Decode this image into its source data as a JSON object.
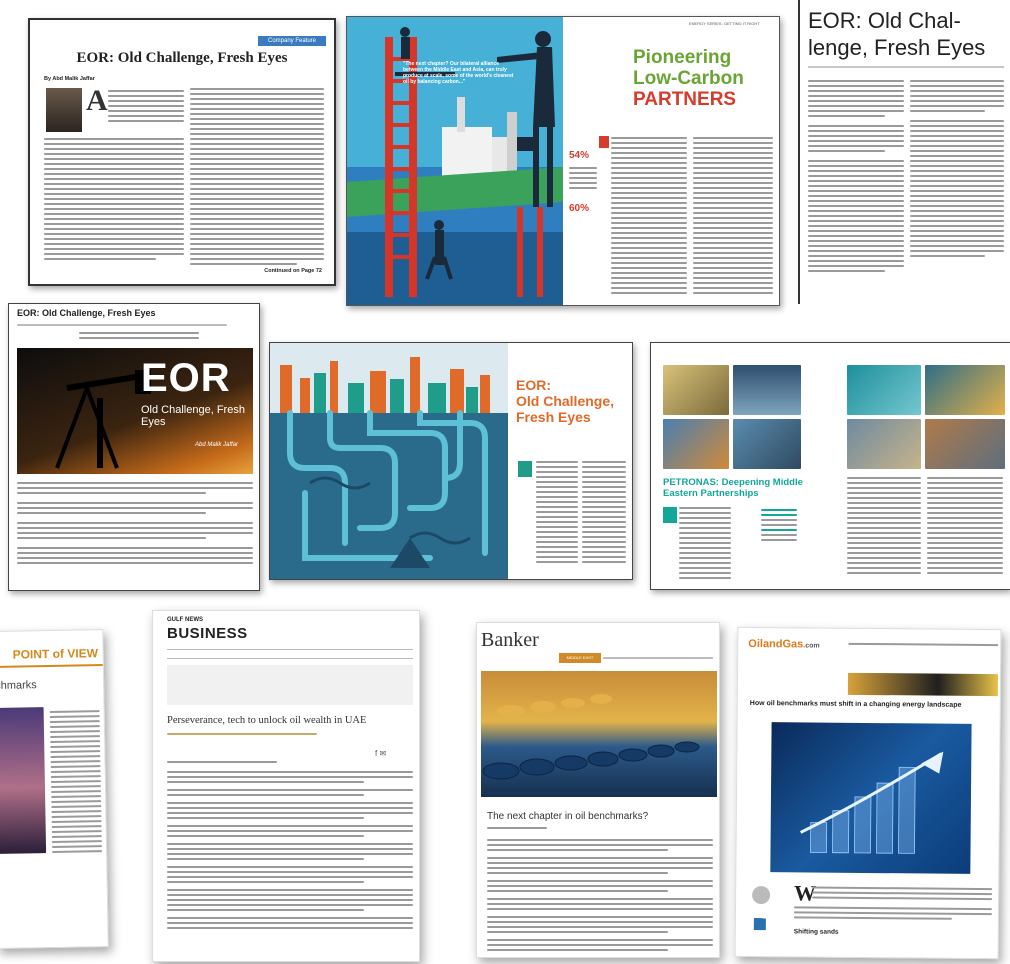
{
  "clip1": {
    "tag": "Company Feature",
    "headline": "EOR: Old Challenge, Fresh Eyes",
    "byline": "By Abd Malik Jaffar",
    "continued": "Continued on Page 72"
  },
  "clip2": {
    "kicker": "ENERGY SERIES: GETTING IT RIGHT",
    "title_line1": "Pioneering",
    "title_line2": "Low-Carbon",
    "title_line3": "PARTNERS",
    "pullquote": "\"The next chapter? Our bilateral alliance between the Middle East and Asia, can truly produce at scale, some of the world's cleanest oil by balancing carbon...\"",
    "stat1": "54%",
    "stat2": "60%"
  },
  "clip3": {
    "headline_line1": "EOR: Old Chal-",
    "headline_line2": "lenge, Fresh Eyes"
  },
  "clip4": {
    "headline": "EOR: Old Challenge, Fresh Eyes",
    "hero_big": "EOR",
    "hero_sub": "Old Challenge, Fresh Eyes",
    "hero_author": "Abd Malik Jaffar"
  },
  "clip5": {
    "title_line1": "EOR:",
    "title_line2": "Old Challenge,",
    "title_line3": "Fresh Eyes"
  },
  "clip6": {
    "title_line1": "PETRONAS: Deepening Middle",
    "title_line2": "Eastern Partnerships"
  },
  "clip7": {
    "header": "POINT of VIEW",
    "sub": "chmarks"
  },
  "clip8": {
    "masthead_small": "GULF NEWS",
    "masthead": "BUSINESS",
    "headline": "Perseverance, tech to unlock oil wealth in UAE"
  },
  "clip9": {
    "masthead": "Banker",
    "headline": "The next chapter in oil benchmarks?",
    "active_tab": "MIDDLE EAST"
  },
  "clip10": {
    "logo": "OilandGas",
    "logo_suffix": ".com",
    "headline": "How oil benchmarks must shift in a changing energy landscape",
    "drop_cap": "W",
    "subhead": "Shifting sands"
  },
  "colors": {
    "petronas_teal": "#13a79a",
    "low_carbon_green": "#6aa534",
    "partners_red": "#d63b2c",
    "eor_orange": "#e06a2a",
    "navy": "#1f3c5a"
  }
}
